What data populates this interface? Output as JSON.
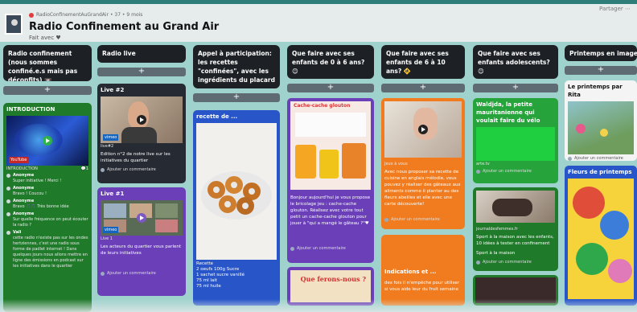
{
  "header": {
    "meta": "RadioConfinementAuGrandAir • 37 • 9 mois",
    "title": "Radio Confinement au Grand Air",
    "subtitle": "Fait avec ♥",
    "right": "Partager ⋯"
  },
  "columns": [
    {
      "title": "Radio confinement (nous sommes confiné.e.s mais pas déconfits) 📼"
    },
    {
      "title": "Radio live"
    },
    {
      "title": "Appel à participation: les recettes \"confinées\", avec les ingrédients du placard"
    },
    {
      "title": "Que faire avec ses enfants de 0 à 6 ans? 😊"
    },
    {
      "title": "Que faire avec ses enfants de 6 à 10 ans? 🚸"
    },
    {
      "title": "Que faire avec ses enfants adolescents? 😊"
    },
    {
      "title": "Printemps en image ! ☀"
    }
  ],
  "plus": "+",
  "cards": {
    "intro": {
      "title": "INTRODUCTION",
      "tag": "YouTube",
      "subtitle": "INTRODUCTION",
      "count": "💬1",
      "comments": [
        {
          "who": "Anonyme",
          "text": "Super initiative ! Merci !"
        },
        {
          "who": "Anonyme",
          "text": "Bravo ! Coucou !"
        },
        {
          "who": "Anonyme",
          "text": "Bravo 🎵🎵 Très bonne idée"
        },
        {
          "who": "Anonyme",
          "text": "Sur quelle fréquence on peut écouter la radio ?"
        },
        {
          "who": "Vali",
          "text": "cette radio n'existe pas sur les ondes hertziennes, c'est une radio sous forme de padlet internet ! Dans quelques jours nous allons mettre en ligne des émissions en podcast sur les initiatives dans le quartier"
        }
      ]
    },
    "live2": {
      "title": "Live #2",
      "tag": "vimeo",
      "meta": "live#2",
      "text": "Edition n°2 de notre live sur les initiatives du quartier",
      "comment": "Ajouter un commentaire"
    },
    "live1": {
      "title": "Live #1",
      "tag": "vimeo",
      "meta": "Live 1",
      "text": "Les acteurs du quartier vous parlent de leurs initiatives",
      "comment": "Ajouter un commentaire"
    },
    "recette": {
      "title": "recette de ...",
      "lines": [
        "Recette",
        "2 oeufs      100g Sucre",
        "1 sachet sucre vanillé",
        "75 ml lait",
        "75 ml huile"
      ]
    },
    "cache": {
      "poster": "Cache-cache glouton",
      "text": "Bonjour aujourd'hui je vous propose le bricolage jeu : cache-cache glouton. Réalisez avec votre tout petit un cache-cache glouton pour jouer à \"qui a mangé le gâteau ?\"♥",
      "comment": "Ajouter un commentaire"
    },
    "quoi": {
      "text": "Que ferons-nous ?"
    },
    "recette2": {
      "meta": "Jeux à vous",
      "text": "Avec nous proposer sa recette de cuisine en anglais mélodie, vous pouvez y réaliser des gâteaux aux aliments comme il planter au des fleurs abeilles et elle avec une carte découverte!",
      "comment": "Ajouter un commentaire"
    },
    "orange2": {
      "title": "Indications et ...",
      "text": "des fois il n'empêche pour utiliser si vous aide leur du fruit semaine"
    },
    "waldo": {
      "title": "Waldjda, la petite mauritanienne qui voulait faire du vélo",
      "meta": "arte.tv",
      "comment": "Ajouter un commentaire"
    },
    "sport": {
      "meta": "journaldesfemmes.fr",
      "text": "Sport à la maison avec les enfants, 10 idées à tester en confinement",
      "sub": "Sport à la maison",
      "comment": "Ajouter un commentaire"
    },
    "printemps": {
      "title": "Le printemps par Rita",
      "comment": "Ajouter un commentaire"
    },
    "fleurs": {
      "title": "Fleurs de printemps"
    }
  }
}
